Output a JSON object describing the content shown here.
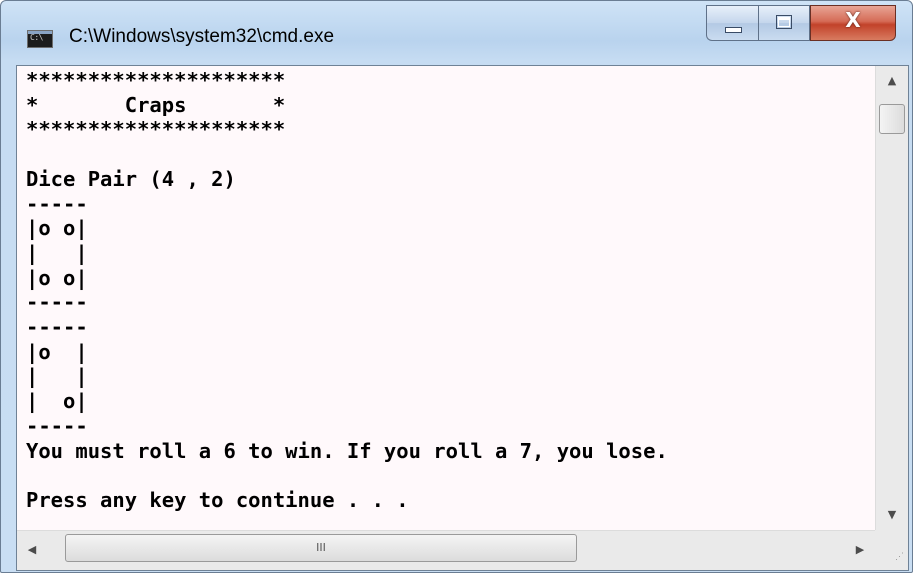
{
  "window": {
    "title": "C:\\Windows\\system32\\cmd.exe",
    "icon": "cmd-icon",
    "icon_text": "C:\\",
    "controls": {
      "minimize_icon": "minimize-icon",
      "maximize_icon": "maximize-icon",
      "close_icon": "close-icon",
      "close_glyph": "X"
    }
  },
  "console": {
    "lines": [
      "*********************",
      "*       Craps       *",
      "*********************",
      "",
      "Dice Pair (4 , 2)",
      "-----",
      "|o o|",
      "|   |",
      "|o o|",
      "-----",
      "-----",
      "|o  |",
      "|   |",
      "|  o|",
      "-----",
      "You must roll a 6 to win. If you roll a 7, you lose.",
      "",
      "Press any key to continue . . ."
    ]
  },
  "scrollbars": {
    "vertical": {
      "up_arrow": "▲",
      "down_arrow": "▼"
    },
    "horizontal": {
      "left_arrow": "◀",
      "right_arrow": "▶",
      "thumb_grip": "III"
    },
    "size_grip": "⋰"
  },
  "colors": {
    "console_background": "#fff9fb",
    "console_text": "#000000",
    "close_button": "#c2422a"
  }
}
